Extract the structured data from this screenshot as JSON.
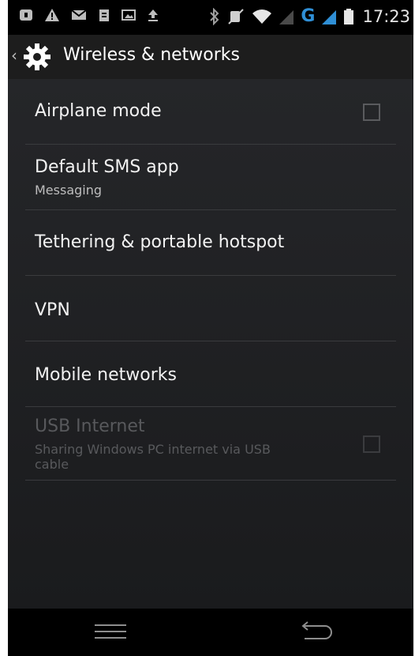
{
  "status_bar": {
    "time": "17:23",
    "network_type": "G",
    "icons": [
      "notification-icon",
      "warning-icon",
      "mail-icon",
      "clipboard-icon",
      "image-icon",
      "upload-icon",
      "bluetooth-icon",
      "mute-icon",
      "wifi-icon",
      "signal-icon",
      "battery-icon"
    ]
  },
  "action_bar": {
    "title": "Wireless & networks",
    "icon": "gear-icon"
  },
  "preferences": [
    {
      "title": "Airplane mode",
      "summary": "",
      "checkbox": true,
      "checked": false,
      "enabled": true
    },
    {
      "title": "Default SMS app",
      "summary": "Messaging",
      "checkbox": false,
      "enabled": true
    },
    {
      "title": "Tethering & portable hotspot",
      "summary": "",
      "checkbox": false,
      "enabled": true
    },
    {
      "title": "VPN",
      "summary": "",
      "checkbox": false,
      "enabled": true
    },
    {
      "title": "Mobile networks",
      "summary": "",
      "checkbox": false,
      "enabled": true
    },
    {
      "title": "USB Internet",
      "summary_line1": "Sharing Windows PC internet via USB",
      "summary_line2": "cable",
      "checkbox": true,
      "checked": false,
      "enabled": false
    }
  ],
  "colors": {
    "accent": "#2f8fd6",
    "background": "#1d1e20",
    "divider": "#3a3b3e"
  },
  "nav_bar": {
    "icons": [
      "menu-icon",
      "back-icon"
    ]
  }
}
